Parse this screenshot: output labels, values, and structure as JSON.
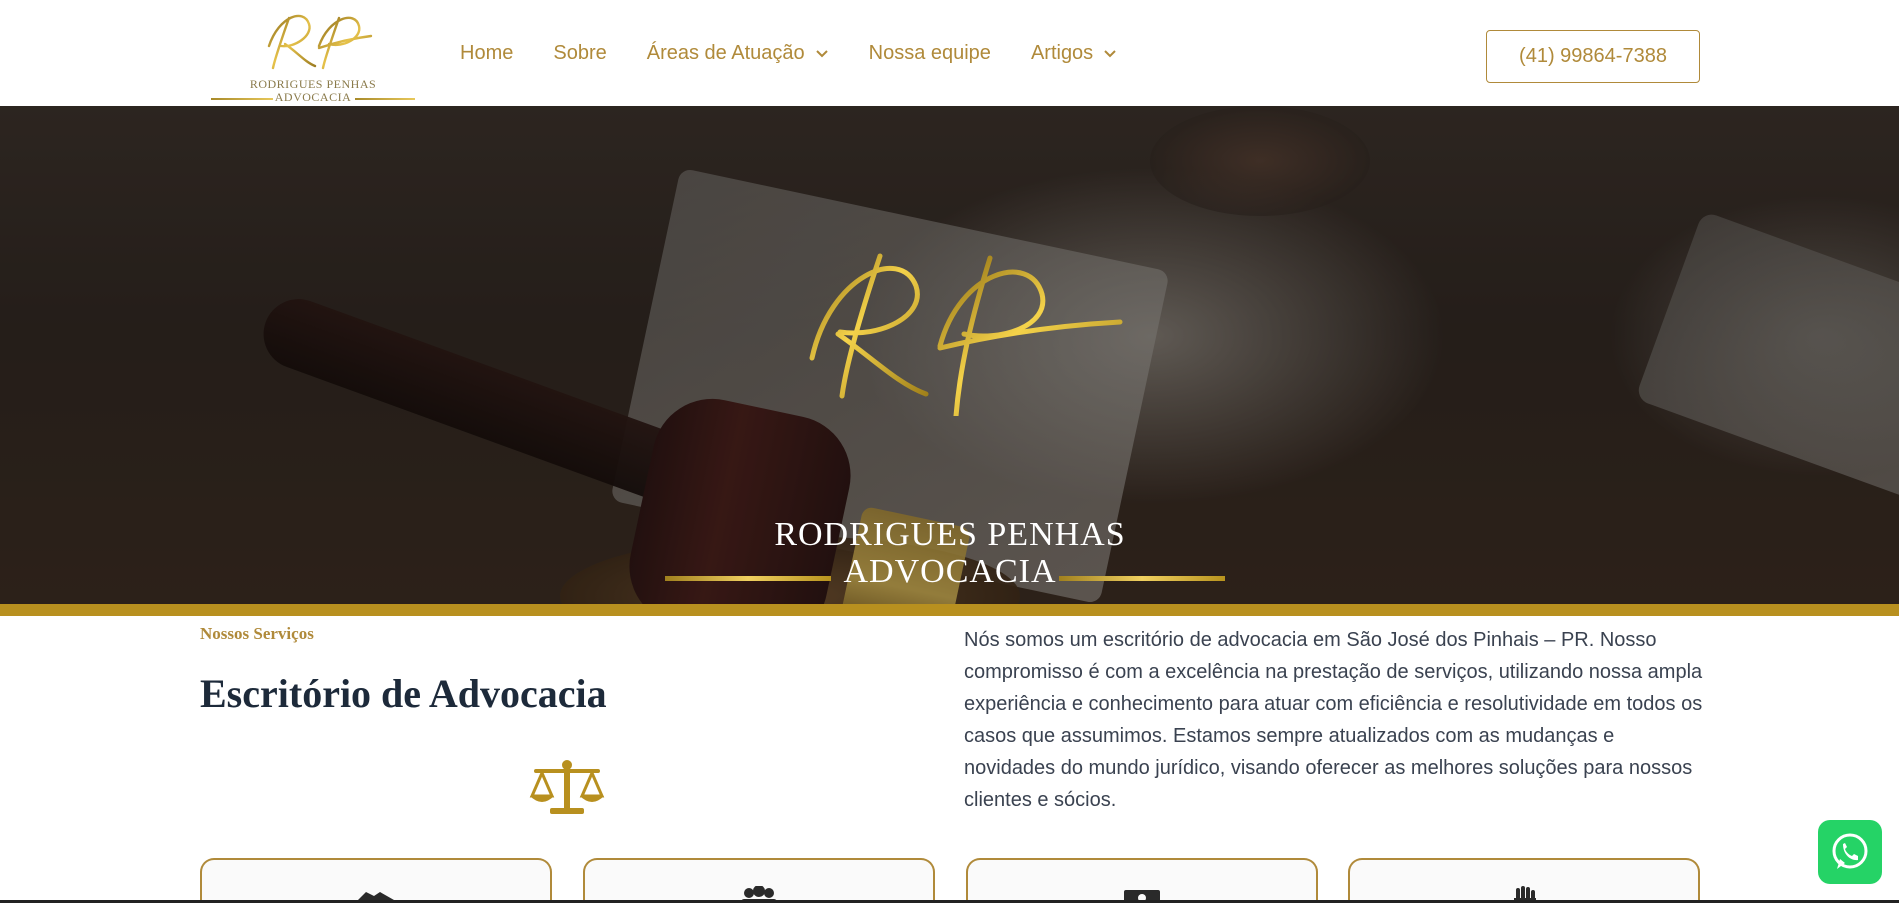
{
  "header": {
    "logo": {
      "monogram": "RP",
      "line1": "RODRIGUES PENHAS",
      "line2": "ADVOCACIA"
    },
    "nav": [
      {
        "label": "Home",
        "has_dropdown": false
      },
      {
        "label": "Sobre",
        "has_dropdown": false
      },
      {
        "label": "Áreas de Atuação",
        "has_dropdown": true
      },
      {
        "label": "Nossa equipe",
        "has_dropdown": false
      },
      {
        "label": "Artigos",
        "has_dropdown": true
      }
    ],
    "phone": "(41) 99864-7388"
  },
  "hero": {
    "monogram": "RP",
    "line1": "RODRIGUES PENHAS",
    "line2": "ADVOCACIA"
  },
  "services": {
    "label": "Nossos Serviços",
    "title": "Escritório de Advocacia",
    "icon": "scales-of-justice-icon",
    "description": "Nós somos um escritório de advocacia em São José dos Pinhais – PR. Nosso compromisso é com a excelência na prestação de serviços, utilizando nossa ampla experiência e conhecimento para atuar com eficiência e resolutividade em todos os casos que assumimos. Estamos sempre atualizados com as mudanças e novidades do mundo jurídico, visando oferecer as melhores soluções para nossos clientes e sócios."
  },
  "cards": [
    {
      "icon": "handshake-icon"
    },
    {
      "icon": "users-icon"
    },
    {
      "icon": "money-icon"
    },
    {
      "icon": "hand-icon"
    }
  ],
  "colors": {
    "gold": "#b08a3a",
    "gold_band": "#b8901f",
    "navy": "#1d2a3a",
    "whatsapp": "#25d366"
  },
  "floating": {
    "whatsapp_icon": "whatsapp-icon"
  }
}
